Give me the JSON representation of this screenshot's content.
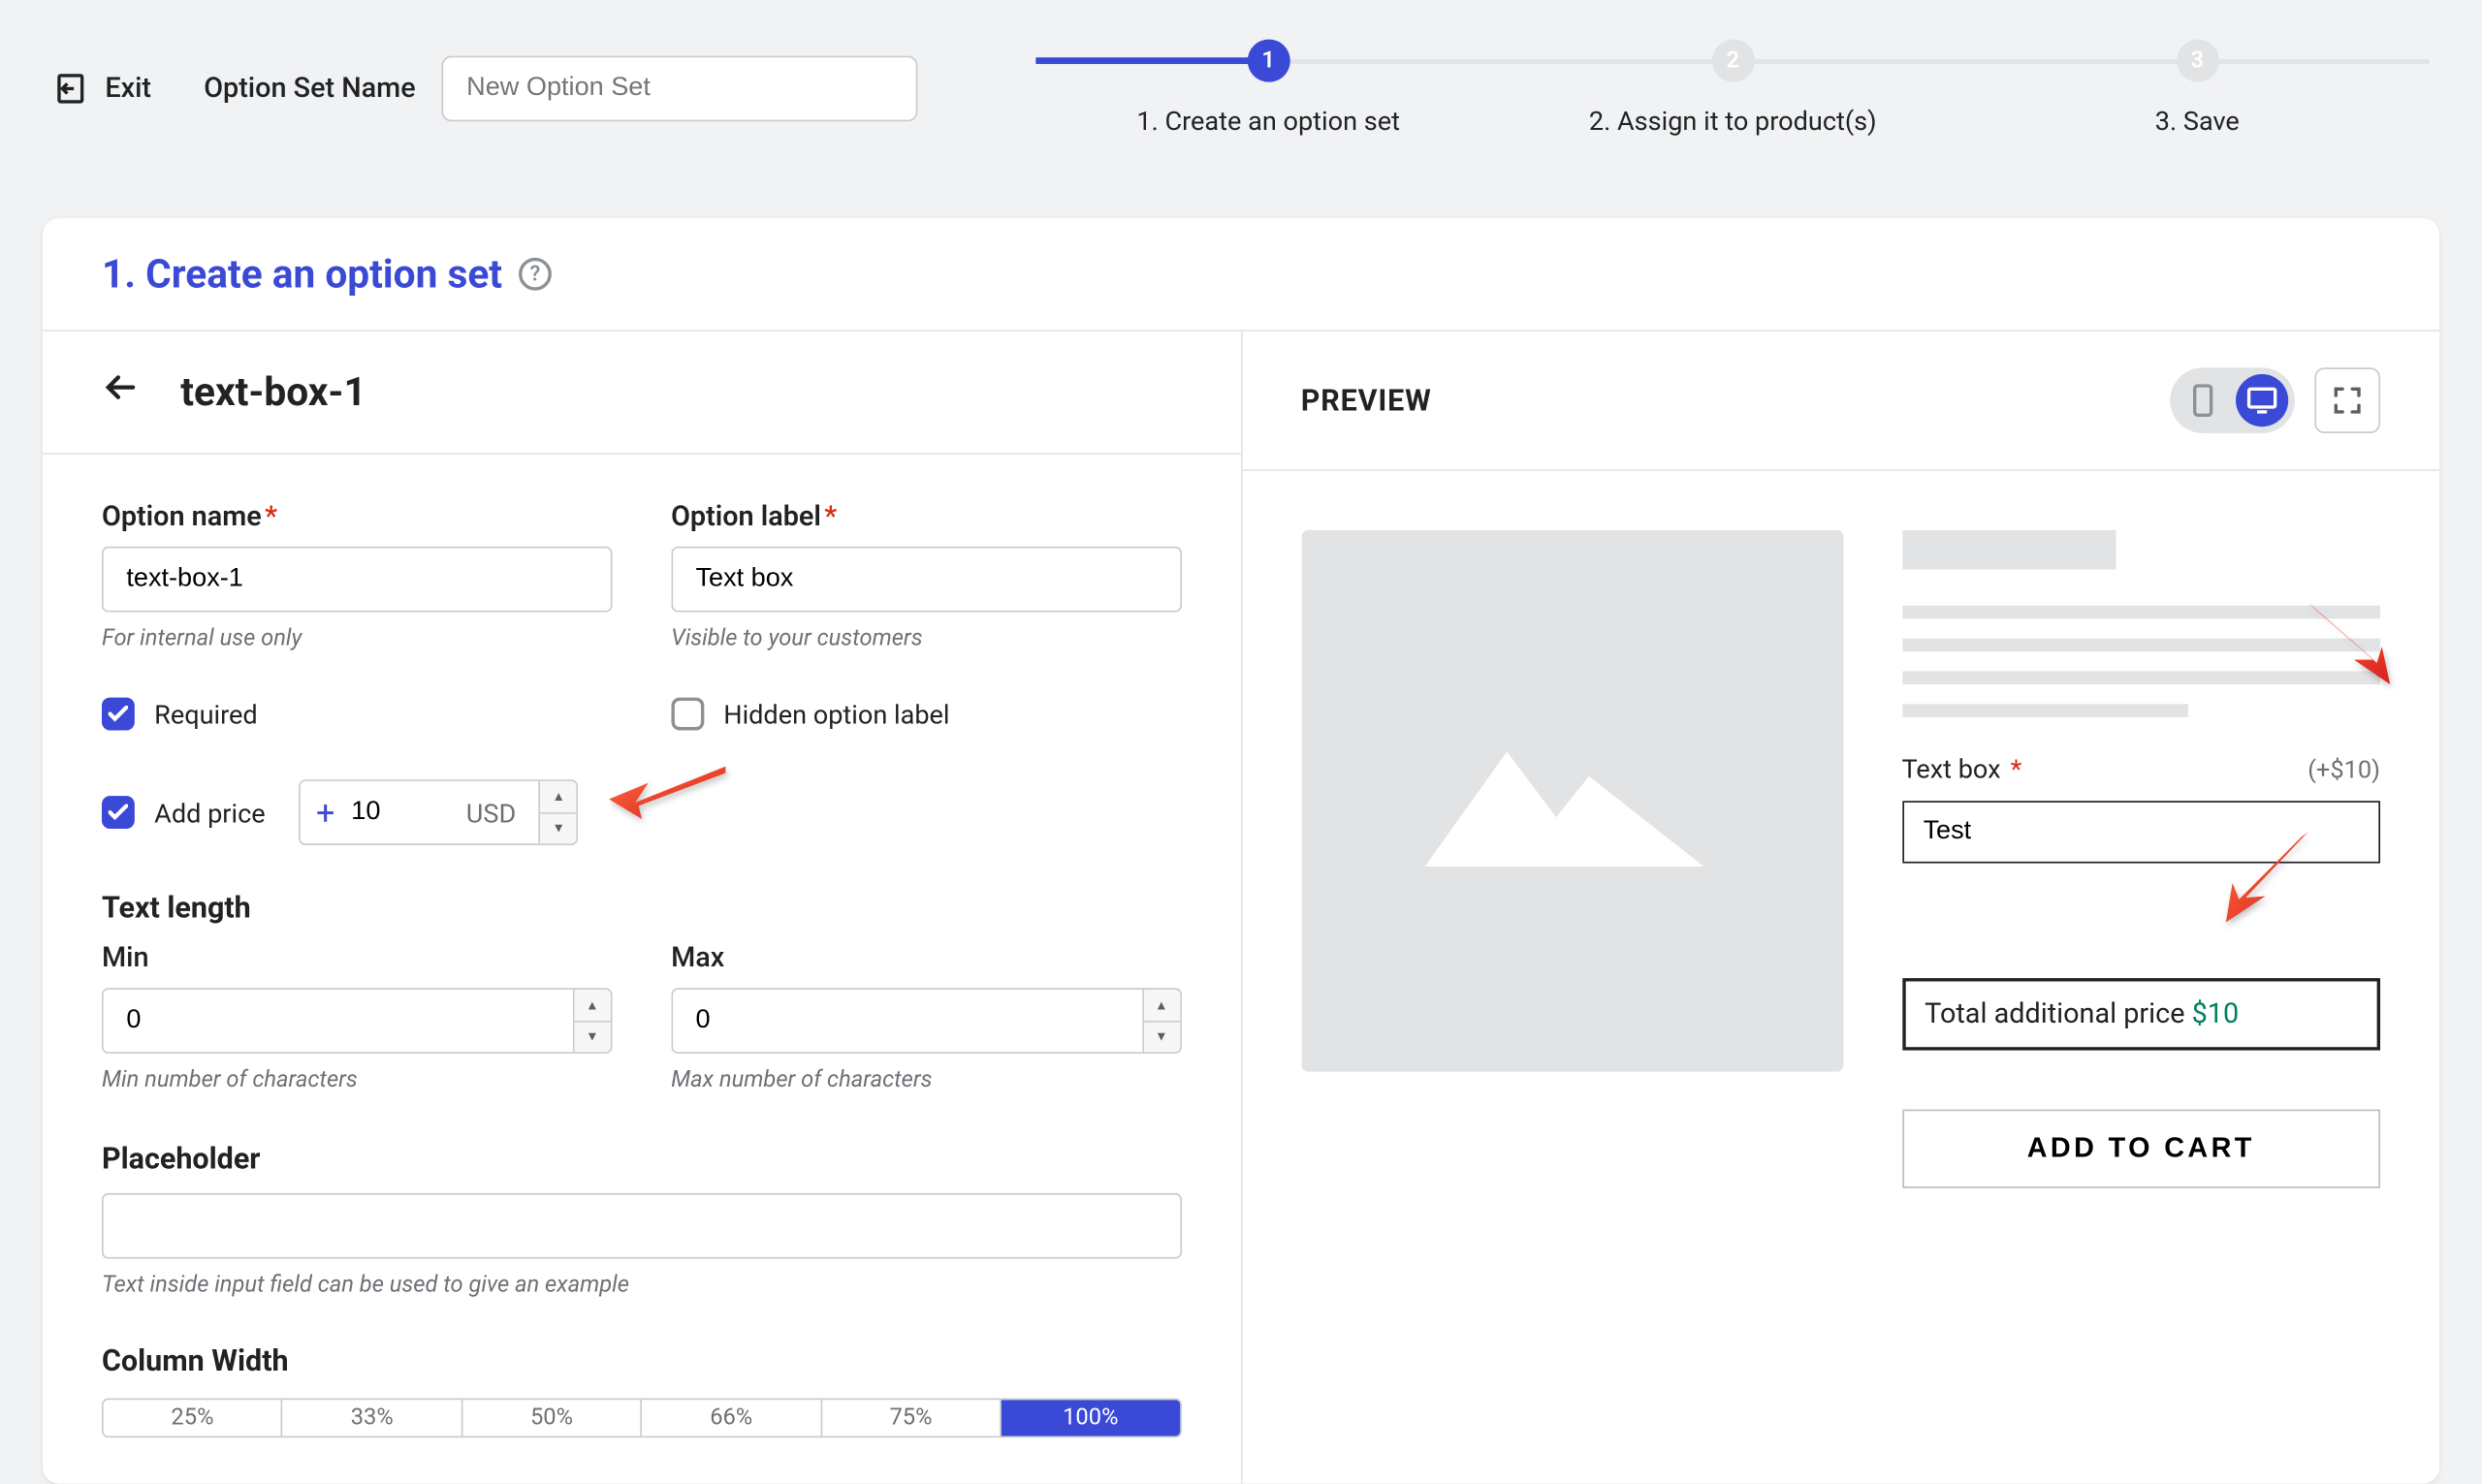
{
  "top": {
    "exit": "Exit",
    "optionSetNameLabel": "Option Set Name",
    "optionSetNamePlaceholder": "New Option Set"
  },
  "steps": {
    "s1": {
      "num": "1",
      "label": "1. Create an option set"
    },
    "s2": {
      "num": "2",
      "label": "2. Assign it to product(s)"
    },
    "s3": {
      "num": "3",
      "label": "3. Save"
    }
  },
  "panel": {
    "title": "1. Create an option set"
  },
  "form": {
    "name": "text-box-1",
    "optionNameLabel": "Option name",
    "optionNameValue": "text-box-1",
    "optionNameHelp": "For internal use only",
    "optionLabelLabel": "Option label",
    "optionLabelValue": "Text box",
    "optionLabelHelp": "Visible to your customers",
    "requiredLabel": "Required",
    "hiddenLabel": "Hidden option label",
    "addPriceLabel": "Add price",
    "priceValue": "10",
    "currency": "USD",
    "textLength": "Text length",
    "minLabel": "Min",
    "maxLabel": "Max",
    "minValue": "0",
    "maxValue": "0",
    "minHelp": "Min number of characters",
    "maxHelp": "Max number of characters",
    "placeholderLabel": "Placeholder",
    "placeholderHelp": "Text inside input field can be used to give an example",
    "columnWidthLabel": "Column Width",
    "colWidths": {
      "o1": "25%",
      "o2": "33%",
      "o3": "50%",
      "o4": "66%",
      "o5": "75%",
      "o6": "100%"
    }
  },
  "preview": {
    "heading": "PREVIEW",
    "optionLabel": "Text box",
    "priceAdd": "(+$10)",
    "inputValue": "Test",
    "totalLabel": "Total additional price ",
    "totalPrice": "$10",
    "addToCart": "ADD TO CART"
  }
}
